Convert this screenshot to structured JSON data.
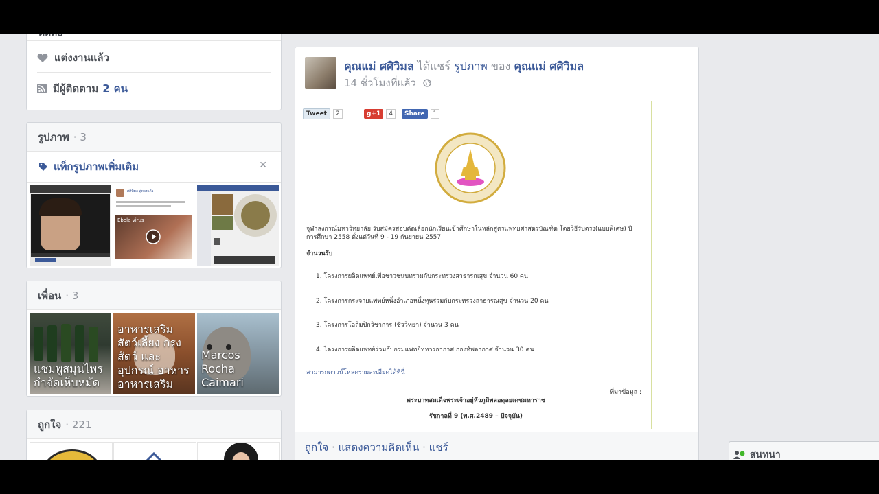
{
  "about": {
    "partial_label": "ติดต่อ",
    "married_label": "แต่งงานแล้ว",
    "followers_prefix": "มีผู้ติดตาม",
    "followers_count": "2",
    "followers_suffix": "คน"
  },
  "photos": {
    "title": "รูปภาพ",
    "count": "· 3",
    "tag_label": "แท็กรูปภาพเพิ่มเติม",
    "close_glyph": "✕",
    "thumb2_name": "ศศิพิมล สู่ทองแก้ว",
    "thumb2_video_title": "Ebola virus"
  },
  "friends": {
    "title": "เพื่อน",
    "count": "· 3",
    "items": [
      {
        "name": "แชมพูสมุนไพร กำจัดเห็บหมัด"
      },
      {
        "name": "อาหารเสริมสัตว์เลี้ยง กรงสัตว์ และอุปกรณ์ อาหาร อาหารเสริม"
      },
      {
        "name": "Marcos Rocha Caimari"
      }
    ]
  },
  "likes": {
    "title": "ถูกใจ",
    "count": "· 221"
  },
  "post": {
    "author": "คุณแม่ ศศิวิมล",
    "shared_text": "ได้แชร์",
    "object_text": "รูปภาพ",
    "of_text": "ของ",
    "owner": "คุณแม่ ศศิวิมล",
    "time": "14 ชั่วโมงที่แล้ว",
    "tweet_label": "Tweet",
    "tweet_count": "2",
    "gplus_label": "g+1",
    "gplus_count": "4",
    "fb_share_label": "Share",
    "fb_share_count": "1",
    "announcement_line1": "จุฬาลงกรณ์มหาวิทยาลัย รับสมัครสอบคัดเลือกนักเรียนเข้าศึกษาในหลักสูตรแพทยศาสตรบัณฑิต โดยวิธีรับตรง(แบบพิเศษ) ปี",
    "announcement_line2": "การศึกษา 2558 ตั้งแต่วันที่ 9 - 19 กันยายน 2557",
    "quota_heading": "จำนวนรับ",
    "programs": [
      "1.  โครงการผลิตแพทย์เพื่อชาวชนบทร่วมกับกระทรวงสาธารณสุข จำนวน 60 คน",
      "2.  โครงการกระจายแพทย์หนึ่งอำเภอหนึ่งทุนร่วมกับกระทรวงสาธารณสุข จำนวน 20 คน",
      "3.  โครงการโอลิมปิกวิชาการ (ชีววิทยา) จำนวน 3 คน",
      "4.  โครงการผลิตแพทย์ร่วมกับกรมแพทย์ทหารอากาศ กองทัพอากาศ จำนวน 30 คน"
    ],
    "download_link": "สามารถดาวน์โหลดรายละเอียดได้ที่นี่",
    "source_label": "ที่มาข้อมูล :",
    "king_line1": "พระบาทสมเด็จพระเจ้าอยู่หัวภูมิพลอดุลยเดชมหาราช",
    "king_line2": "รัชกาลที่ 9 (พ.ศ.2489 – ปัจจุบัน)",
    "action_like": "ถูกใจ",
    "action_comment": "แสดงความคิดเห็น",
    "action_share": "แชร์",
    "sep": "·"
  },
  "chat": {
    "label": "สนทนา"
  },
  "colors": {
    "fb_blue": "#3b5998",
    "bg": "#e9eaed",
    "online": "#42b72a"
  }
}
